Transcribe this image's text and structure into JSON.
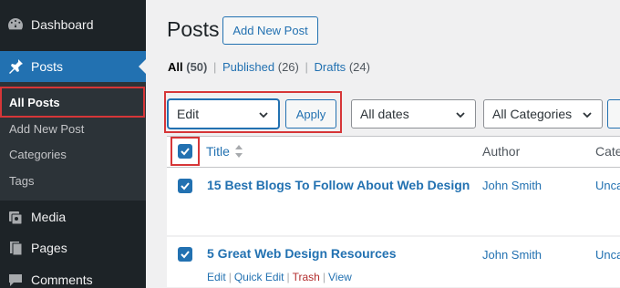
{
  "sidebar": {
    "items": [
      {
        "label": "Dashboard",
        "icon": "dashboard-icon"
      },
      {
        "label": "Posts",
        "icon": "pin-icon"
      },
      {
        "label": "Media",
        "icon": "media-icon"
      },
      {
        "label": "Pages",
        "icon": "pages-icon"
      },
      {
        "label": "Comments",
        "icon": "comments-icon"
      }
    ],
    "submenu": [
      "All Posts",
      "Add New Post",
      "Categories",
      "Tags"
    ]
  },
  "header": {
    "title": "Posts",
    "add_new_label": "Add New Post"
  },
  "views": {
    "all_label": "All",
    "all_count": "(50)",
    "published_label": "Published",
    "published_count": "(26)",
    "drafts_label": "Drafts",
    "drafts_count": "(24)",
    "separator": "|"
  },
  "filters": {
    "bulk_action": "Edit",
    "apply_label": "Apply",
    "dates": "All dates",
    "categories": "All Categories"
  },
  "table": {
    "columns": {
      "title": "Title",
      "author": "Author",
      "categories": "Cate"
    },
    "rows": [
      {
        "title": "15 Best Blogs To Follow About Web Design",
        "author": "John Smith",
        "category": "Unca"
      },
      {
        "title": "5 Great Web Design Resources",
        "author": "John Smith",
        "category": "Unca"
      }
    ],
    "row_actions": {
      "edit": "Edit",
      "quick_edit": "Quick Edit",
      "trash": "Trash",
      "view": "View"
    }
  },
  "colors": {
    "accent": "#2271b1",
    "sidebar": "#1d2327",
    "highlight": "#d63638"
  }
}
